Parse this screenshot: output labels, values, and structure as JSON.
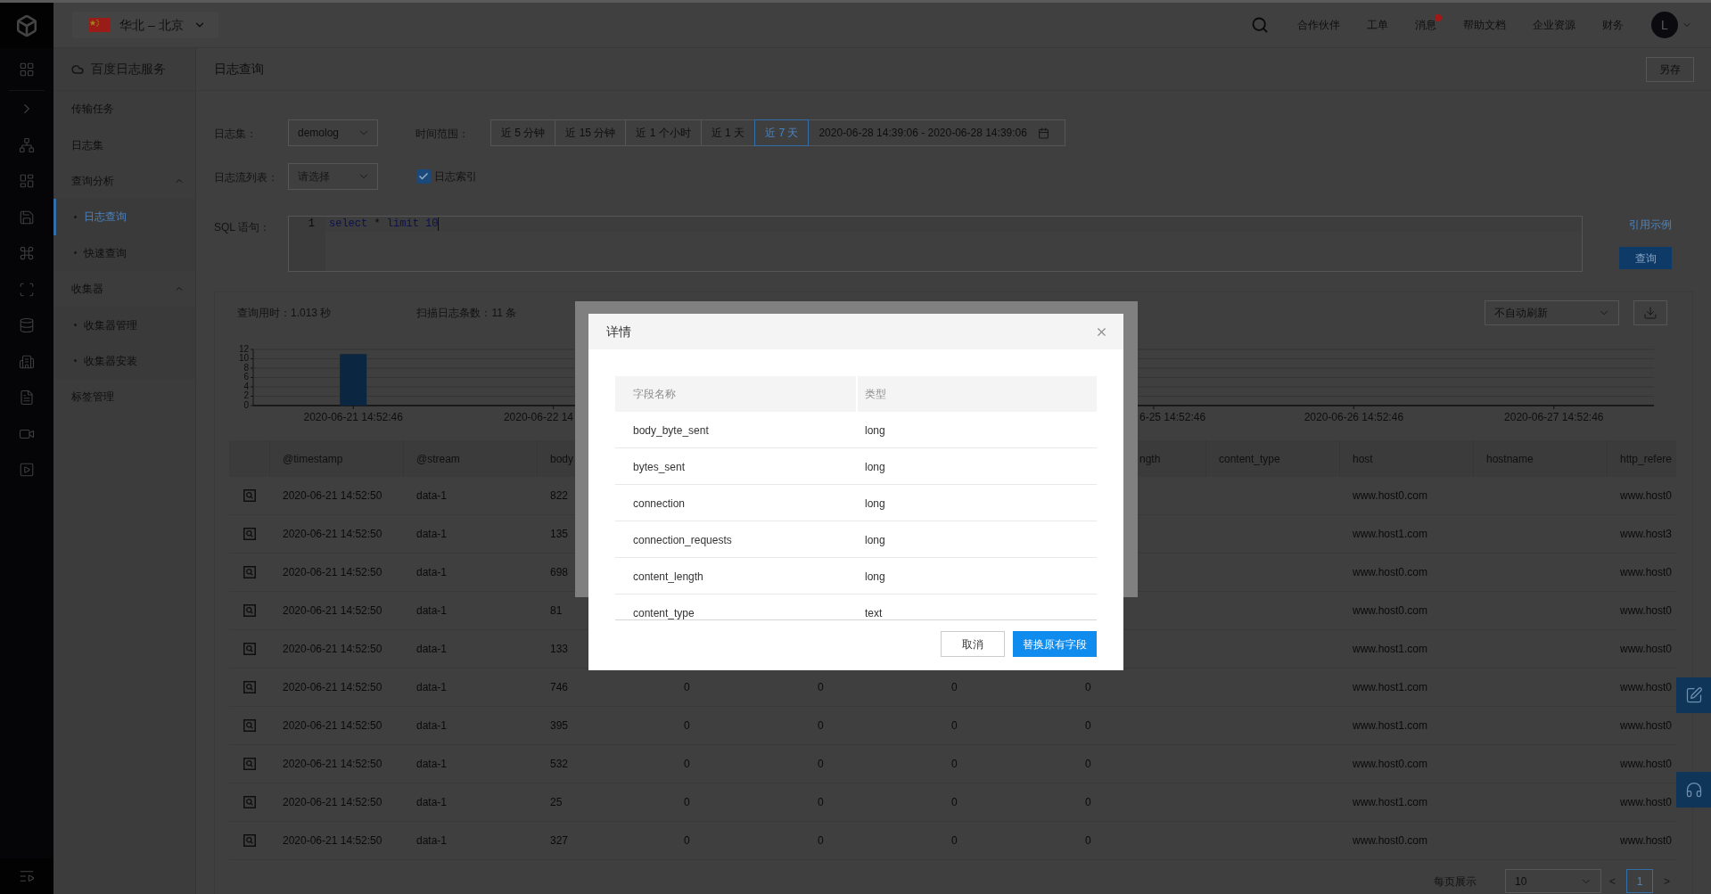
{
  "topbar": {
    "region": "华北 – 北京",
    "links": [
      {
        "label": "合作伙伴",
        "dot": false
      },
      {
        "label": "工单",
        "dot": false
      },
      {
        "label": "消息",
        "dot": true
      },
      {
        "label": "帮助文档",
        "dot": false
      },
      {
        "label": "企业资源",
        "dot": false
      },
      {
        "label": "财务",
        "dot": false
      }
    ],
    "avatar": "L"
  },
  "sidebar": {
    "title": "百度日志服务",
    "items": [
      {
        "label": "传输任务",
        "selected": false
      },
      {
        "label": "日志集",
        "selected": false
      },
      {
        "label": "查询分析",
        "selected": false,
        "expanded": true,
        "children": [
          {
            "label": "日志查询",
            "selected": true
          },
          {
            "label": "快速查询",
            "selected": false
          }
        ]
      },
      {
        "label": "收集器",
        "selected": false,
        "expanded": true,
        "children": [
          {
            "label": "收集器管理",
            "selected": false
          },
          {
            "label": "收集器安装",
            "selected": false
          }
        ]
      },
      {
        "label": "标签管理",
        "selected": false
      }
    ]
  },
  "page": {
    "title": "日志查询",
    "save_button": "另存"
  },
  "query_form": {
    "logset": {
      "label": "日志集：",
      "value": "demolog"
    },
    "time_range": {
      "label": "时间范围：",
      "options": [
        {
          "label": "近 5 分钟",
          "selected": false
        },
        {
          "label": "近 15 分钟",
          "selected": false
        },
        {
          "label": "近 1 个小时",
          "selected": false
        },
        {
          "label": "近 1 天",
          "selected": false
        },
        {
          "label": "近 7 天",
          "selected": true
        }
      ],
      "date_range": "2020-06-28 14:39:06 - 2020-06-28 14:39:06"
    },
    "stream_list": {
      "label": "日志流列表：",
      "placeholder": "请选择"
    },
    "index_checkbox": {
      "label": "日志索引",
      "checked": true
    },
    "sql": {
      "label": "SQL 语句：",
      "line_number": "1",
      "tokens": [
        {
          "text": "select",
          "kind": "keyword"
        },
        {
          "text": "*",
          "kind": "operator"
        },
        {
          "text": "limit",
          "kind": "keyword"
        },
        {
          "text": "10",
          "kind": "number"
        }
      ]
    },
    "example_link": "引用示例",
    "query_button": "查询"
  },
  "results": {
    "stats": [
      "查询用时：1.013 秒",
      "扫描日志条数：11 条"
    ],
    "refresh_select": "不自动刷新",
    "chart_data": {
      "type": "bar",
      "categories": [
        "2020-06-21 14:52:46",
        "2020-06-22 14",
        null,
        null,
        "6-25 14:52:46",
        "2020-06-26 14:52:46",
        "2020-06-27 14:52:46"
      ],
      "values": [
        11,
        0,
        null,
        null,
        0,
        0,
        0
      ],
      "ylim": [
        0,
        12
      ],
      "yticks": [
        0,
        2,
        4,
        6,
        8,
        10,
        12
      ],
      "grid": true
    },
    "table": {
      "columns": [
        {
          "label": "@timestamp"
        },
        {
          "label": "@stream"
        },
        {
          "label": "body"
        },
        {},
        {},
        {},
        {
          "label": "ngth"
        },
        {
          "label": "content_type"
        },
        {
          "label": "host"
        },
        {
          "label": "hostname"
        },
        {
          "label": "http_refere"
        }
      ],
      "rows": [
        {
          "cells": [
            "2020-06-21 14:52:50",
            "data-1",
            "822",
            null,
            null,
            null,
            null,
            null,
            "www.host0.com",
            null,
            "www.host0"
          ]
        },
        {
          "cells": [
            "2020-06-21 14:52:50",
            "data-1",
            "135",
            null,
            null,
            null,
            null,
            null,
            "www.host1.com",
            null,
            "www.host3"
          ]
        },
        {
          "cells": [
            "2020-06-21 14:52:50",
            "data-1",
            "698",
            null,
            null,
            null,
            null,
            null,
            "www.host0.com",
            null,
            "www.host0"
          ]
        },
        {
          "cells": [
            "2020-06-21 14:52:50",
            "data-1",
            "81",
            null,
            null,
            null,
            null,
            null,
            "www.host0.com",
            null,
            "www.host0"
          ]
        },
        {
          "cells": [
            "2020-06-21 14:52:50",
            "data-1",
            "133",
            null,
            null,
            null,
            null,
            null,
            "www.host1.com",
            null,
            "www.host0"
          ]
        },
        {
          "cells": [
            "2020-06-21 14:52:50",
            "data-1",
            "746",
            "0",
            "0",
            "0",
            "0",
            null,
            "www.host1.com",
            null,
            "www.host0"
          ]
        },
        {
          "cells": [
            "2020-06-21 14:52:50",
            "data-1",
            "395",
            "0",
            "0",
            "0",
            "0",
            null,
            "www.host1.com",
            null,
            "www.host0"
          ]
        },
        {
          "cells": [
            "2020-06-21 14:52:50",
            "data-1",
            "532",
            "0",
            "0",
            "0",
            "0",
            null,
            "www.host0.com",
            null,
            "www.host0"
          ]
        },
        {
          "cells": [
            "2020-06-21 14:52:50",
            "data-1",
            "25",
            "0",
            "0",
            "0",
            "0",
            null,
            "www.host1.com",
            null,
            "www.host0"
          ]
        },
        {
          "cells": [
            "2020-06-21 14:52:50",
            "data-1",
            "327",
            "0",
            "0",
            "0",
            "0",
            null,
            "www.host0.com",
            null,
            "www.host0"
          ]
        }
      ]
    },
    "pagination": {
      "label": "每页展示",
      "page_size": "10",
      "prev": "<",
      "pages": [
        {
          "label": "1",
          "selected": true
        }
      ],
      "next": ">"
    }
  },
  "dialog": {
    "title": "详情",
    "columns": [
      "字段名称",
      "类型"
    ],
    "rows": [
      {
        "name": "body_byte_sent",
        "type": "long"
      },
      {
        "name": "bytes_sent",
        "type": "long"
      },
      {
        "name": "connection",
        "type": "long"
      },
      {
        "name": "connection_requests",
        "type": "long"
      },
      {
        "name": "content_length",
        "type": "long"
      },
      {
        "name": "content_type",
        "type": "text"
      }
    ],
    "buttons": [
      {
        "label": "取消",
        "kind": "secondary"
      },
      {
        "label": "替换原有字段",
        "kind": "primary"
      }
    ]
  }
}
